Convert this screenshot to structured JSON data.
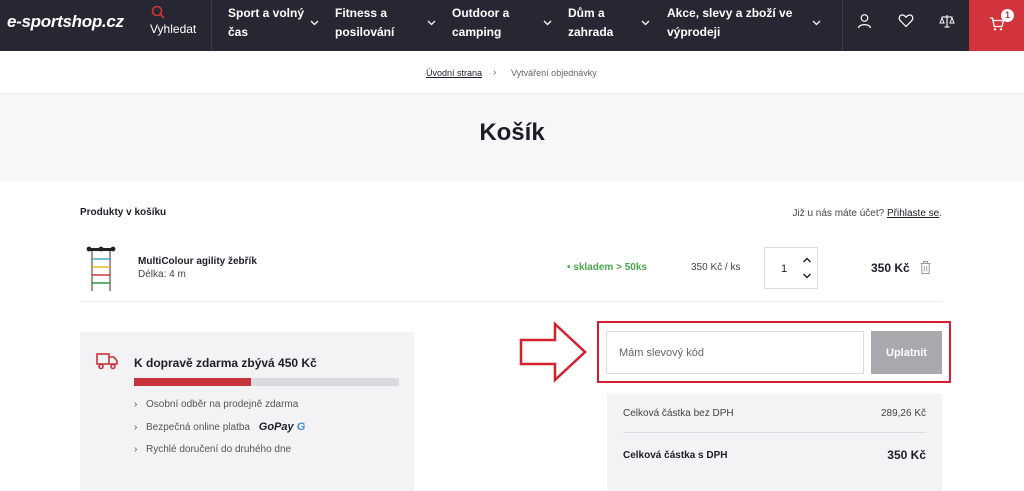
{
  "nav": {
    "logo": "e-sportshop.cz",
    "search_label": "Vyhledat",
    "menu": [
      {
        "line1": "Sport a volný",
        "line2": "čas"
      },
      {
        "line1": "Fitness a",
        "line2": "posilování"
      },
      {
        "line1": "Outdoor a",
        "line2": "camping"
      },
      {
        "line1": "Dům a",
        "line2": "zahrada"
      },
      {
        "line1": "Akce, slevy a zboží ve",
        "line2": "výprodeji"
      }
    ],
    "cart_count": "1",
    "accent_color": "#d2343c",
    "icons": [
      "search-icon",
      "user-icon",
      "heart-icon",
      "compare-icon",
      "cart-icon"
    ]
  },
  "breadcrumb": {
    "home": "Úvodní strana",
    "separator": "›",
    "current": "Vytváření objednávky"
  },
  "page": {
    "title": "Košík"
  },
  "cart": {
    "section_label": "Produkty v košíku",
    "login_prefix": "Již u nás máte účet?",
    "login_link": "Přihlaste se",
    "login_suffix": ".",
    "item": {
      "name": "MultiColour agility žebřík",
      "variant": "Délka: 4 m",
      "stock": "• skladem > 50ks",
      "unit_price": "350 Kč / ks",
      "quantity": "1",
      "total": "350 Kč"
    }
  },
  "shipping": {
    "title": "K dopravě zdarma zbývá 450 Kč",
    "progress_fraction": 0.44,
    "benefits": [
      "Osobní odběr na prodejně zdarma",
      "Bezpečná online platba",
      "Rychlé doručení do druhého dne"
    ],
    "payment_logo": "GoPay"
  },
  "discount": {
    "placeholder": "Mám slevový kód",
    "apply_label": "Uplatnit"
  },
  "totals": {
    "without_vat_label": "Celková částka bez DPH",
    "without_vat_value": "289,26 Kč",
    "with_vat_label": "Celková částka s DPH",
    "with_vat_value": "350 Kč"
  }
}
